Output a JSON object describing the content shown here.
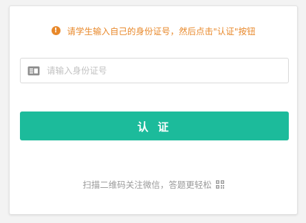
{
  "notice": {
    "icon": "exclamation-circle-icon",
    "text": "请学生输入自己的身份证号，然后点击\"认证\"按钮",
    "color": "#e8882a"
  },
  "id_input": {
    "icon": "id-card-icon",
    "placeholder": "请输入身份证号",
    "value": ""
  },
  "verify_button": {
    "label": "认 证",
    "color": "#1cbb9b"
  },
  "footer": {
    "text": "扫描二维码关注微信，答题更轻松",
    "icon": "qr-code-icon"
  }
}
